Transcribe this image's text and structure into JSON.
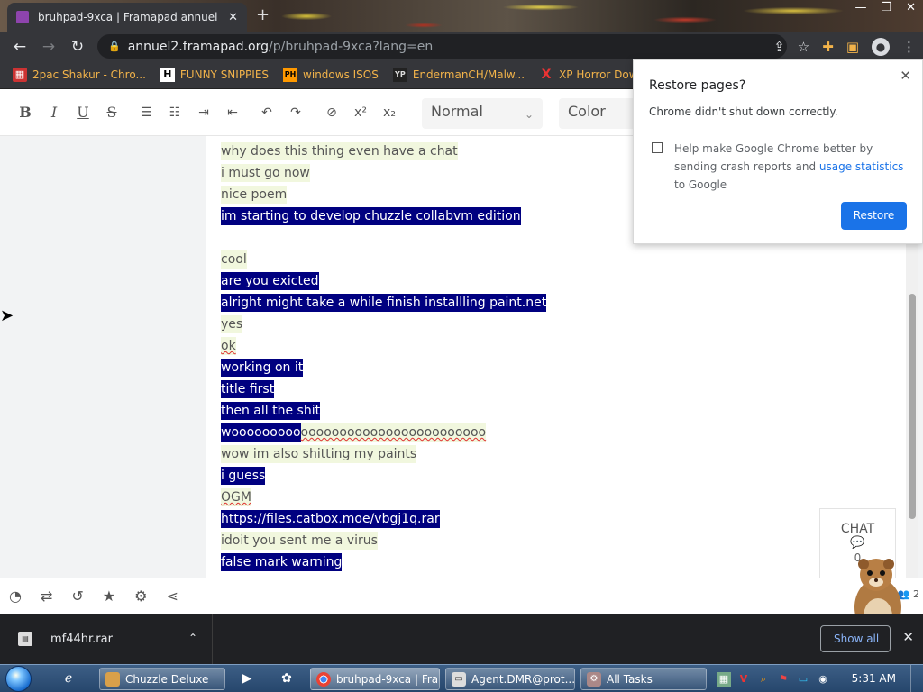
{
  "browser": {
    "tab_title": "bruhpad-9xca | Framapad annuel",
    "new_tab": "+",
    "url_host": "annuel2.framapad.org",
    "url_path": "/p/bruhpad-9xca?lang=en"
  },
  "bookmarks": [
    {
      "label": "2pac Shakur - Chro...",
      "icon": "img-icon"
    },
    {
      "label": "FUNNY SNIPPIES",
      "icon": "H"
    },
    {
      "label": "windows ISOS",
      "icon": "PH"
    },
    {
      "label": "EndermanCH/Malw...",
      "icon": "YP"
    },
    {
      "label": "XP Horror Download",
      "icon": "X"
    }
  ],
  "editor": {
    "style_select": "Normal",
    "color_select": "Color"
  },
  "pad_lines": [
    {
      "text": "why does this thing even have a chat",
      "author": "a"
    },
    {
      "text": "i must go now",
      "author": "a"
    },
    {
      "text": "nice poem",
      "author": "a"
    },
    {
      "text": "im starting to develop chuzzle collabvm edition",
      "author": "b"
    },
    {
      "text": "",
      "author": "none"
    },
    {
      "text": "cool",
      "author": "a"
    },
    {
      "text": "are you exicted",
      "author": "b"
    },
    {
      "text": "alright might take a while finish installling paint.net",
      "author": "b"
    },
    {
      "text": "yes",
      "author": "a"
    },
    {
      "text": "ok",
      "author": "a"
    },
    {
      "text": "working on it",
      "author": "b"
    },
    {
      "text": "title first",
      "author": "b"
    },
    {
      "text": "then all the shit",
      "author": "b"
    },
    {
      "text": "wooooooooooooooooooooooooooooooooo",
      "author": "mixed",
      "split": 10
    },
    {
      "text": "wow im also shitting my paints",
      "author": "a"
    },
    {
      "text": "i guess",
      "author": "b"
    },
    {
      "text": "OGM",
      "author": "a"
    },
    {
      "text": "https://files.catbox.moe/vbgj1q.rar",
      "author": "b",
      "link": true
    },
    {
      "text": "idoit you sent me a virus",
      "author": "a"
    },
    {
      "text": "false mark warning",
      "author": "b"
    }
  ],
  "restore_popup": {
    "title": "Restore pages?",
    "subtitle": "Chrome didn't shut down correctly.",
    "help_text": "Help make Google Chrome better by sending crash reports and",
    "help_link": "usage statistics",
    "help_suffix": "to Google",
    "button": "Restore"
  },
  "chat": {
    "label": "CHAT",
    "count": "0"
  },
  "user_count": "2",
  "download": {
    "file": "mf44hr.rar",
    "show_all": "Show all"
  },
  "taskbar": {
    "items": [
      {
        "label": "Chuzzle Deluxe"
      },
      {
        "label": "bruhpad-9xca | Fra..."
      },
      {
        "label": "Agent.DMR@prot..."
      },
      {
        "label": "All Tasks"
      }
    ],
    "clock": "5:31 AM"
  },
  "colors": {
    "author_a_bg": "#f1f7de",
    "author_b_bg": "#000080",
    "chrome_dark": "#35363a",
    "accent_blue": "#1a73e8"
  }
}
